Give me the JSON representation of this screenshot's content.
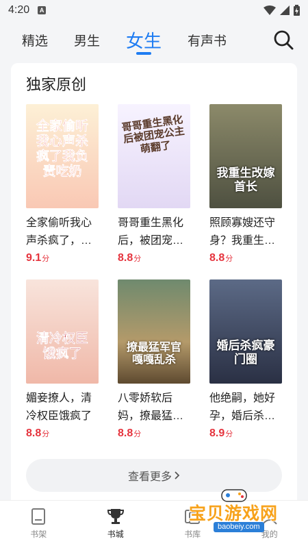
{
  "status": {
    "time": "4:20",
    "notice_glyph": "A"
  },
  "nav": {
    "tabs": [
      {
        "label": "精选"
      },
      {
        "label": "男生"
      },
      {
        "label": "女生",
        "active": true
      },
      {
        "label": "有声书"
      }
    ]
  },
  "section": {
    "title": "独家原创",
    "more_label": "查看更多"
  },
  "books": [
    {
      "title": "全家偷听我心声杀疯了，我负责吃奶",
      "score": "9.1",
      "unit": "分",
      "cover_text": "全家偷听我心声杀疯了我负责吃奶",
      "cover_bg": "#fde7d8"
    },
    {
      "title": "哥哥重生黑化后，被团宠公主萌翻了",
      "score": "8.8",
      "unit": "分",
      "cover_text": "哥哥重生黑化后被团宠公主萌翻了",
      "cover_bg": "#f3eefb"
    },
    {
      "title": "照顾寡嫂还守身？我重生改嫁首长",
      "score": "8.8",
      "unit": "分",
      "cover_text": "我重生改嫁首长",
      "cover_bg": "#6b6a52"
    },
    {
      "title": "媚妾撩人，清冷权臣饿疯了",
      "score": "8.8",
      "unit": "分",
      "cover_text": "清冷权臣饿疯了",
      "cover_bg": "#f6d9cf"
    },
    {
      "title": "八零娇软后妈，撩最猛军官嘎嘎乱杀",
      "score": "8.8",
      "unit": "分",
      "cover_text": "撩最猛军官嘎嘎乱杀",
      "cover_bg": "#9a8d63"
    },
    {
      "title": "他绝嗣，她好孕，婚后杀疯豪门圈",
      "score": "8.9",
      "unit": "分",
      "cover_text": "婚后杀疯豪门圈",
      "cover_bg": "#3a4458"
    }
  ],
  "bottom_nav": [
    {
      "label": "书架",
      "icon": "bookshelf-icon"
    },
    {
      "label": "书城",
      "icon": "trophy-icon",
      "active": true
    },
    {
      "label": "书库",
      "icon": "library-icon"
    },
    {
      "label": "我的",
      "icon": "profile-icon"
    }
  ],
  "watermark": {
    "text": "宝贝游戏网",
    "url": "baobeiy.com"
  },
  "colors": {
    "accent": "#1e7cf2",
    "score": "#e5333d"
  }
}
